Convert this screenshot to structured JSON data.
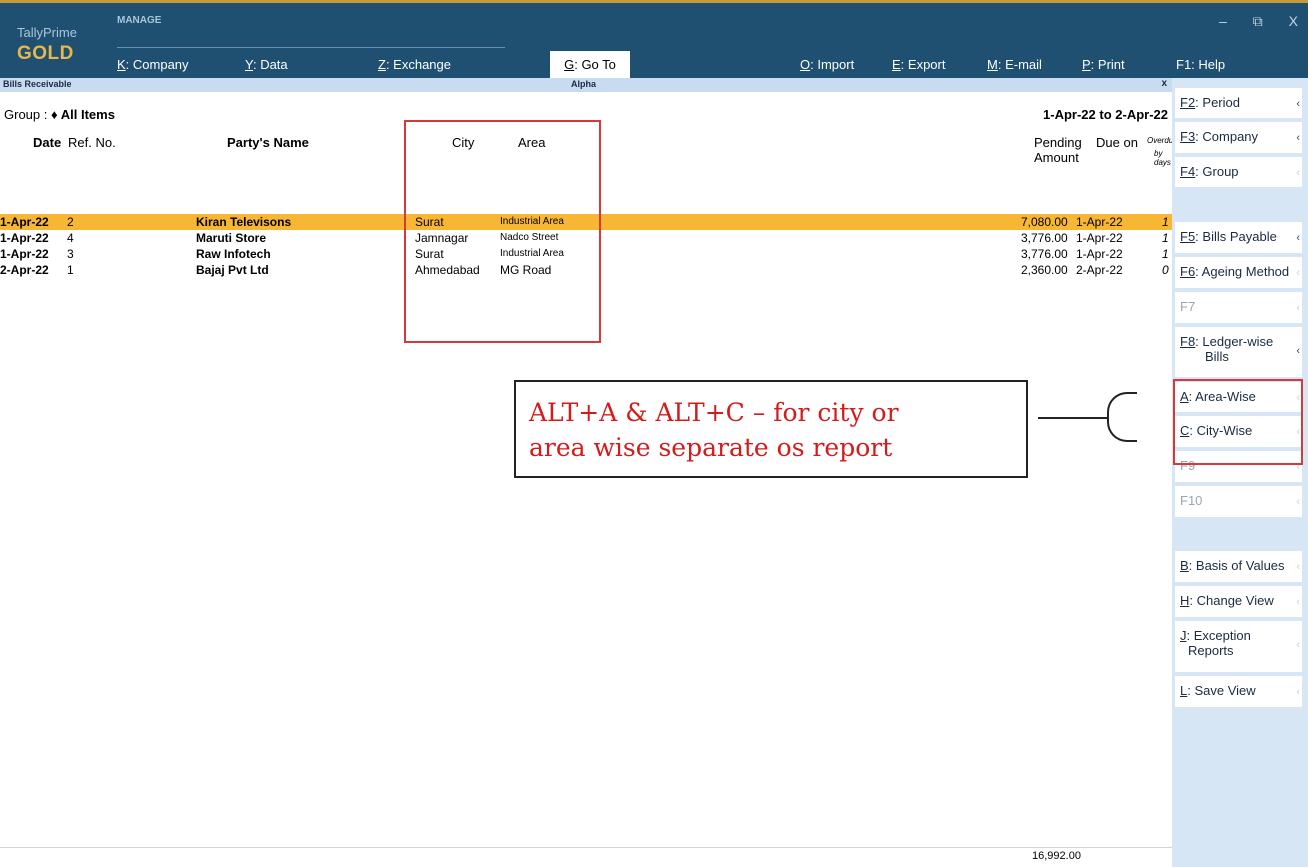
{
  "topbar": {
    "brand_line1": "TallyPrime",
    "brand_line2": "GOLD",
    "section_label": "MANAGE",
    "menu": [
      {
        "key": "K",
        "label": ": Company"
      },
      {
        "key": "Y",
        "label": ": Data"
      },
      {
        "key": "Z",
        "label": ": Exchange"
      },
      {
        "key": "O",
        "label": ": Import"
      },
      {
        "key": "E",
        "label": ": Export"
      },
      {
        "key": "M",
        "label": ": E-mail"
      },
      {
        "key": "P",
        "label": ": Print"
      }
    ],
    "goto": {
      "key": "G",
      "label": ": Go To"
    },
    "help": "F1: Help",
    "window_controls": [
      "–",
      "⧉",
      "X"
    ]
  },
  "strip": {
    "title": "Bills Receivable",
    "company": "Alpha",
    "close": "x"
  },
  "report": {
    "group_label": "Group :",
    "group_value": "♦ All Items",
    "period": "1-Apr-22 to 2-Apr-22",
    "headers": {
      "date": "Date",
      "ref": "Ref. No.",
      "party": "Party's Name",
      "city": "City",
      "area": "Area",
      "pending_1": "Pending",
      "pending_2": "Amount",
      "due": "Due on",
      "overdue_1": "Overdue",
      "overdue_2": "by days"
    },
    "rows": [
      {
        "date": "1-Apr-22",
        "ref": "2",
        "party": "Kiran Televisons",
        "city": "Surat",
        "area": "Industrial Area",
        "amount": "7,080.00",
        "due": "1-Apr-22",
        "overdue": "1"
      },
      {
        "date": "1-Apr-22",
        "ref": "4",
        "party": "Maruti Store",
        "city": "Jamnagar",
        "area": "Nadco Street",
        "amount": "3,776.00",
        "due": "1-Apr-22",
        "overdue": "1"
      },
      {
        "date": "1-Apr-22",
        "ref": "3",
        "party": "Raw Infotech",
        "city": "Surat",
        "area": "Industrial Area",
        "amount": "3,776.00",
        "due": "1-Apr-22",
        "overdue": "1"
      },
      {
        "date": "2-Apr-22",
        "ref": "1",
        "party": "Bajaj Pvt Ltd",
        "city": "Ahmedabad",
        "area": "MG Road",
        "amount": "2,360.00",
        "due": "2-Apr-22",
        "overdue": "0"
      }
    ],
    "total": "16,992.00"
  },
  "annotation": {
    "line1": "ALT+A & ALT+C – for city or",
    "line2": "area wise separate os report"
  },
  "right_panel": {
    "buttons": [
      {
        "key": "F2",
        "label": ": Period"
      },
      {
        "key": "F3",
        "label": ": Company"
      },
      {
        "key": "F4",
        "label": ": Group"
      },
      {
        "key": "F5",
        "label": ": Bills Payable"
      },
      {
        "key": "F6",
        "label": ": Ageing Method"
      },
      {
        "key": "F7",
        "label": ""
      },
      {
        "key": "F8",
        "label": ": Ledger-wise",
        "label2": "Bills"
      },
      {
        "key": "A",
        "label": ": Area-Wise"
      },
      {
        "key": "C",
        "label": ": City-Wise"
      },
      {
        "key": "F9",
        "label": ""
      },
      {
        "key": "F10",
        "label": ""
      },
      {
        "key": "B",
        "label": ": Basis of Values"
      },
      {
        "key": "H",
        "label": ": Change View"
      },
      {
        "key": "J",
        "label": ": Exception",
        "label2": "Reports"
      },
      {
        "key": "L",
        "label": ": Save View"
      }
    ]
  }
}
